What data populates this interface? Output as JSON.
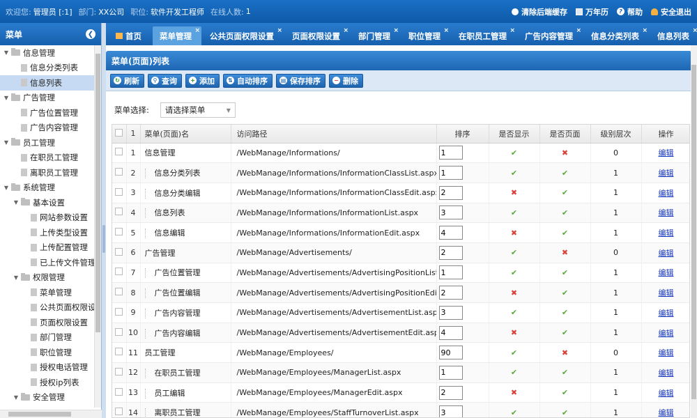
{
  "topbar": {
    "welcome_label": "欢迎您:",
    "user": "管理员 [:1]",
    "dept_label": "部门:",
    "dept": "XX公司",
    "post_label": "职位:",
    "post": "软件开发工程师",
    "online_label": "在线人数:",
    "online": "1",
    "clear_cache": "清除后端缓存",
    "calendar": "万年历",
    "help": "帮助",
    "logout": "安全退出"
  },
  "sidebar": {
    "title": "菜单",
    "items": [
      {
        "label": "信息管理",
        "level": 0,
        "type": "folder",
        "expanded": true
      },
      {
        "label": "信息分类列表",
        "level": 1,
        "type": "page"
      },
      {
        "label": "信息列表",
        "level": 1,
        "type": "page",
        "selected": true
      },
      {
        "label": "广告管理",
        "level": 0,
        "type": "folder",
        "expanded": true
      },
      {
        "label": "广告位置管理",
        "level": 1,
        "type": "page"
      },
      {
        "label": "广告内容管理",
        "level": 1,
        "type": "page"
      },
      {
        "label": "员工管理",
        "level": 0,
        "type": "folder",
        "expanded": true
      },
      {
        "label": "在职员工管理",
        "level": 1,
        "type": "page"
      },
      {
        "label": "离职员工管理",
        "level": 1,
        "type": "page"
      },
      {
        "label": "系统管理",
        "level": 0,
        "type": "folder",
        "expanded": true
      },
      {
        "label": "基本设置",
        "level": 1,
        "type": "folder",
        "expanded": true
      },
      {
        "label": "网站参数设置",
        "level": 2,
        "type": "page"
      },
      {
        "label": "上传类型设置",
        "level": 2,
        "type": "page"
      },
      {
        "label": "上传配置管理",
        "level": 2,
        "type": "page"
      },
      {
        "label": "已上传文件管理",
        "level": 2,
        "type": "page"
      },
      {
        "label": "权限管理",
        "level": 1,
        "type": "folder",
        "expanded": true
      },
      {
        "label": "菜单管理",
        "level": 2,
        "type": "page"
      },
      {
        "label": "公共页面权限设",
        "level": 2,
        "type": "page"
      },
      {
        "label": "页面权限设置",
        "level": 2,
        "type": "page"
      },
      {
        "label": "部门管理",
        "level": 2,
        "type": "page"
      },
      {
        "label": "职位管理",
        "level": 2,
        "type": "page"
      },
      {
        "label": "授权电话管理",
        "level": 2,
        "type": "page"
      },
      {
        "label": "授权ip列表",
        "level": 2,
        "type": "page"
      },
      {
        "label": "安全管理",
        "level": 1,
        "type": "folder",
        "expanded": true
      }
    ]
  },
  "tabs": [
    {
      "label": "首页",
      "home": true,
      "closable": false
    },
    {
      "label": "菜单管理",
      "active": true,
      "closable": true
    },
    {
      "label": "公共页面权限设置",
      "closable": true
    },
    {
      "label": "页面权限设置",
      "closable": true
    },
    {
      "label": "部门管理",
      "closable": true
    },
    {
      "label": "职位管理",
      "closable": true
    },
    {
      "label": "在职员工管理",
      "closable": true
    },
    {
      "label": "广告内容管理",
      "closable": true
    },
    {
      "label": "信息分类列表",
      "closable": true
    },
    {
      "label": "信息列表",
      "closable": true
    }
  ],
  "panel": {
    "title": "菜单(页面)列表"
  },
  "toolbar": {
    "refresh": "刷新",
    "search": "查询",
    "add": "添加",
    "auto_sort": "自动排序",
    "save_sort": "保存排序",
    "delete": "删除"
  },
  "filter": {
    "label": "菜单选择:",
    "selected": "请选择菜单"
  },
  "grid": {
    "columns": {
      "num": "1",
      "name": "菜单(页面)名",
      "path": "访问路径",
      "sort": "排序",
      "show": "是否显示",
      "page": "是否页面",
      "level": "级别层次",
      "op": "操作"
    },
    "edit_label": "编辑",
    "yes_symbol": "✔",
    "no_symbol": "✖",
    "rows": [
      {
        "n": "1",
        "name": "信息管理",
        "child": false,
        "path": "/WebManage/Informations/",
        "sort": "1",
        "show": true,
        "page": false,
        "level": "0"
      },
      {
        "n": "2",
        "name": "信息分类列表",
        "child": true,
        "path": "/WebManage/Informations/InformationClassList.aspx",
        "sort": "1",
        "show": true,
        "page": true,
        "level": "1"
      },
      {
        "n": "3",
        "name": "信息分类编辑",
        "child": true,
        "path": "/WebManage/Informations/InformationClassEdit.aspx",
        "sort": "2",
        "show": false,
        "page": true,
        "level": "1"
      },
      {
        "n": "4",
        "name": "信息列表",
        "child": true,
        "path": "/WebManage/Informations/InformationList.aspx",
        "sort": "3",
        "show": true,
        "page": true,
        "level": "1"
      },
      {
        "n": "5",
        "name": "信息编辑",
        "child": true,
        "path": "/WebManage/Informations/InformationEdit.aspx",
        "sort": "4",
        "show": false,
        "page": true,
        "level": "1"
      },
      {
        "n": "6",
        "name": "广告管理",
        "child": false,
        "path": "/WebManage/Advertisements/",
        "sort": "2",
        "show": true,
        "page": false,
        "level": "0"
      },
      {
        "n": "7",
        "name": "广告位置管理",
        "child": true,
        "path": "/WebManage/Advertisements/AdvertisingPositionList.aspx",
        "sort": "1",
        "show": true,
        "page": true,
        "level": "1"
      },
      {
        "n": "8",
        "name": "广告位置编辑",
        "child": true,
        "path": "/WebManage/Advertisements/AdvertisingPositionEdit.aspx",
        "sort": "2",
        "show": false,
        "page": true,
        "level": "1"
      },
      {
        "n": "9",
        "name": "广告内容管理",
        "child": true,
        "path": "/WebManage/Advertisements/AdvertisementList.aspx",
        "sort": "3",
        "show": true,
        "page": true,
        "level": "1"
      },
      {
        "n": "10",
        "name": "广告内容编辑",
        "child": true,
        "path": "/WebManage/Advertisements/AdvertisementEdit.aspx",
        "sort": "4",
        "show": false,
        "page": true,
        "level": "1"
      },
      {
        "n": "11",
        "name": "员工管理",
        "child": false,
        "path": "/WebManage/Employees/",
        "sort": "90",
        "show": true,
        "page": false,
        "level": "0"
      },
      {
        "n": "12",
        "name": "在职员工管理",
        "child": true,
        "path": "/WebManage/Employees/ManagerList.aspx",
        "sort": "1",
        "show": true,
        "page": true,
        "level": "1"
      },
      {
        "n": "13",
        "name": "员工编辑",
        "child": true,
        "path": "/WebManage/Employees/ManagerEdit.aspx",
        "sort": "2",
        "show": false,
        "page": true,
        "level": "1"
      },
      {
        "n": "14",
        "name": "离职员工管理",
        "child": true,
        "path": "/WebManage/Employees/StaffTurnoverList.aspx",
        "sort": "3",
        "show": true,
        "page": true,
        "level": "1"
      }
    ]
  }
}
